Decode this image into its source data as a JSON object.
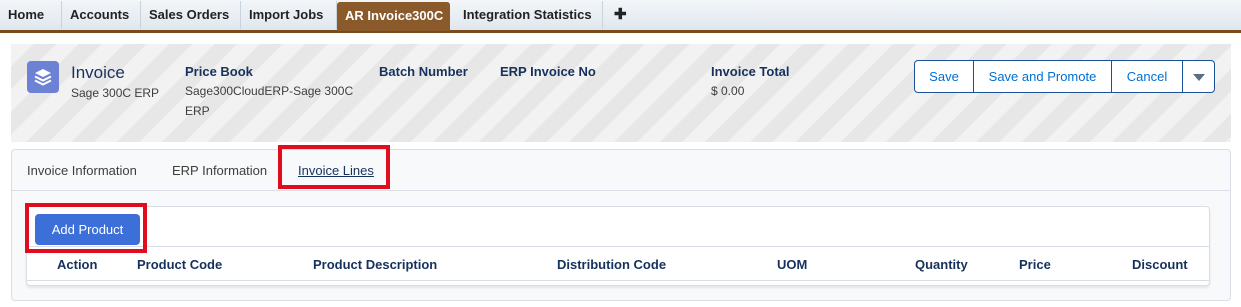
{
  "nav": {
    "tabs": [
      {
        "label": "Home"
      },
      {
        "label": "Accounts"
      },
      {
        "label": "Sales Orders"
      },
      {
        "label": "Import Jobs"
      },
      {
        "label": "AR Invoice300C"
      },
      {
        "label": "Integration Statistics"
      }
    ],
    "plus": "✚"
  },
  "header": {
    "object_label": "Invoice",
    "object_sub": "Sage 300C ERP",
    "fields": [
      {
        "label": "Price Book",
        "value_line1": "Sage300CloudERP-Sage 300C",
        "value_line2": "ERP"
      },
      {
        "label": "Batch Number",
        "value_line1": ""
      },
      {
        "label": "ERP Invoice No",
        "value_line1": ""
      },
      {
        "label": "Invoice Total",
        "value_line1": "$ 0.00"
      }
    ],
    "buttons": {
      "save": "Save",
      "save_promote": "Save and Promote",
      "cancel": "Cancel"
    }
  },
  "detail_tabs": [
    {
      "label": "Invoice Information"
    },
    {
      "label": "ERP Information"
    },
    {
      "label": "Invoice Lines"
    }
  ],
  "lines": {
    "add_button": "Add Product",
    "columns": [
      "Action",
      "Product Code",
      "Product Description",
      "Distribution Code",
      "UOM",
      "Quantity",
      "Price",
      "Discount"
    ]
  },
  "colors": {
    "active_tab": "#8a5a2b",
    "primary_button": "#3d6fd8",
    "highlight": "#e00d1f"
  }
}
